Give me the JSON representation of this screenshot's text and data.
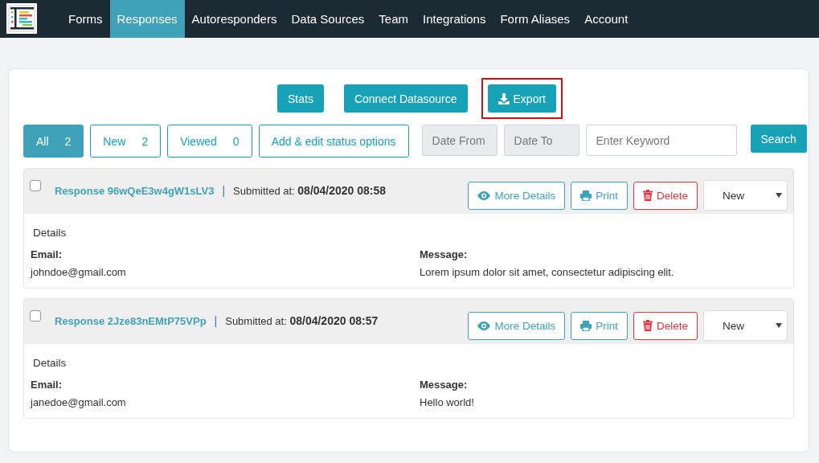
{
  "nav": {
    "items": [
      {
        "label": "Forms",
        "selected": false
      },
      {
        "label": "Responses",
        "selected": true
      },
      {
        "label": "Autoresponders",
        "selected": false
      },
      {
        "label": "Data Sources",
        "selected": false
      },
      {
        "label": "Team",
        "selected": false
      },
      {
        "label": "Integrations",
        "selected": false
      },
      {
        "label": "Form Aliases",
        "selected": false
      },
      {
        "label": "Account",
        "selected": false
      }
    ]
  },
  "actions": [
    {
      "label": "Stats",
      "kind": "plain",
      "highlighted": false
    },
    {
      "label": "Connect Datasource",
      "kind": "plain",
      "highlighted": false
    },
    {
      "label": "Export",
      "kind": "download",
      "highlighted": true
    }
  ],
  "filters": [
    {
      "label": "All",
      "count": "2",
      "selected": true
    },
    {
      "label": "New",
      "count": "2",
      "selected": false
    },
    {
      "label": "Viewed",
      "count": "0",
      "selected": false
    }
  ],
  "status_options_button": "Add & edit status options",
  "search": {
    "date_from": {
      "placeholder": "Date From"
    },
    "date_to": {
      "placeholder": "Date To"
    },
    "keyword": {
      "placeholder": "Enter Keyword"
    },
    "button": "Search"
  },
  "responses": [
    {
      "checked": false,
      "title": "Response 96wQeE3w4gW1sLV3",
      "separator": "|",
      "submitted_label": "Submitted at:",
      "submitted_at": "08/04/2020 08:58",
      "buttons": {
        "details": "More Details",
        "print": "Print",
        "delete": "Delete"
      },
      "status": "New",
      "details_heading": "Details",
      "fields": [
        {
          "label": "Email:",
          "value": "johndoe@gmail.com"
        },
        {
          "label": "Message:",
          "value": "Lorem ipsum dolor sit amet, consectetur adipiscing elit."
        }
      ]
    },
    {
      "checked": false,
      "title": "Response 2Jze83nEMtP75VPp",
      "separator": "|",
      "submitted_label": "Submitted at:",
      "submitted_at": "08/04/2020 08:57",
      "buttons": {
        "details": "More Details",
        "print": "Print",
        "delete": "Delete"
      },
      "status": "New",
      "details_heading": "Details",
      "fields": [
        {
          "label": "Email:",
          "value": "janedoe@gmail.com"
        },
        {
          "label": "Message:",
          "value": "Hello world!"
        }
      ]
    }
  ]
}
